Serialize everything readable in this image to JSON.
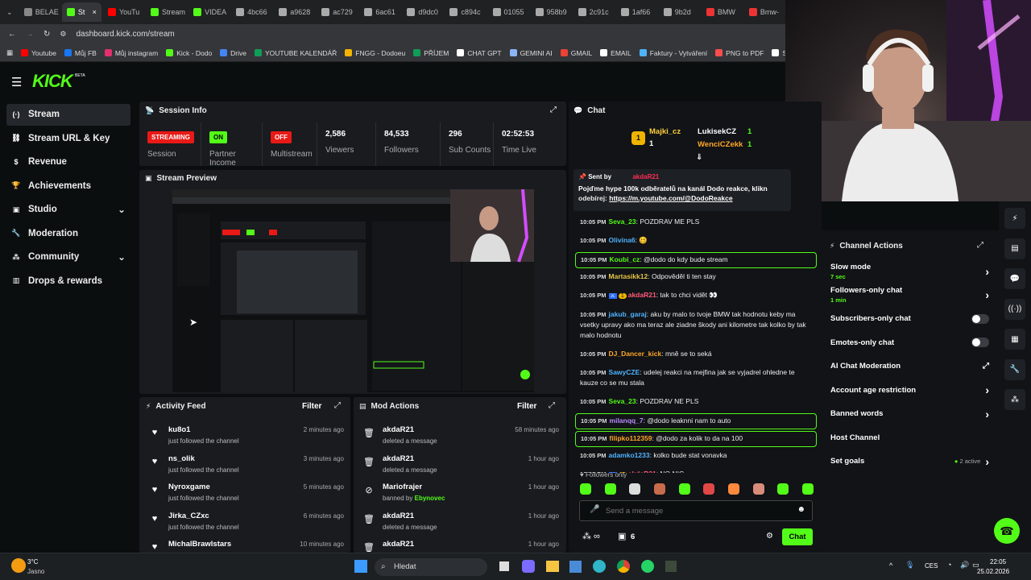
{
  "browser": {
    "tabs": [
      "BELAE",
      "St",
      "YouTu",
      "Stream",
      "VIDEA",
      "4bc66",
      "a9628",
      "ac729",
      "6ac61",
      "d9dc0",
      "c894c",
      "01055",
      "958b9",
      "2c91c",
      "1af66",
      "9b2d",
      "BMW",
      "Bmw-"
    ],
    "url": "dashboard.kick.com/stream",
    "bookmarks": [
      "Youtube",
      "Můj FB",
      "Můj instagram",
      "Kick - Dodo",
      "Drive",
      "YOUTUBE KALENDÁŘ",
      "FNGG - Dodoeu",
      "PŘÍJEM",
      "CHAT GPT",
      "GEMINI AI",
      "GMAIL",
      "EMAIL",
      "Faktury - Vytváření",
      "PNG to PDF",
      "S"
    ]
  },
  "header": {
    "logo": "KICK",
    "logo_sup": "BETA"
  },
  "sidebar": {
    "items": [
      {
        "label": "Stream",
        "icon": "stream-icon"
      },
      {
        "label": "Stream URL & Key",
        "icon": "link-icon"
      },
      {
        "label": "Revenue",
        "icon": "dollar-icon"
      },
      {
        "label": "Achievements",
        "icon": "trophy-icon"
      },
      {
        "label": "Studio",
        "icon": "tv-icon"
      },
      {
        "label": "Moderation",
        "icon": "wrench-icon"
      },
      {
        "label": "Community",
        "icon": "people-icon"
      },
      {
        "label": "Drops & rewards",
        "icon": "chart-icon"
      }
    ]
  },
  "session": {
    "title": "Session Info",
    "stats": [
      {
        "value": "STREAMING",
        "label": "Session",
        "chip": true,
        "color": "#e91916"
      },
      {
        "value": "ON",
        "label": "Partner Income",
        "chip": true,
        "color": "#53fc18"
      },
      {
        "value": "OFF",
        "label": "Multistream",
        "chip": true,
        "color": "#e91916"
      },
      {
        "value": "2,586",
        "label": "Viewers"
      },
      {
        "value": "84,533",
        "label": "Followers"
      },
      {
        "value": "296",
        "label": "Sub Counts"
      },
      {
        "value": "02:52:53",
        "label": "Time Live"
      }
    ]
  },
  "preview": {
    "title": "Stream Preview"
  },
  "activity": {
    "title": "Activity Feed",
    "filter": "Filter",
    "rows": [
      {
        "name": "ku8o1",
        "sub": "just followed the channel",
        "time": "2 minutes ago"
      },
      {
        "name": "ns_olik",
        "sub": "just followed the channel",
        "time": "3 minutes ago"
      },
      {
        "name": "Nyroxgame",
        "sub": "just followed the channel",
        "time": "5 minutes ago"
      },
      {
        "name": "Jirka_CZxc",
        "sub": "just followed the channel",
        "time": "6 minutes ago"
      },
      {
        "name": "MichalBrawlstars",
        "sub": "",
        "time": "10 minutes ago"
      }
    ]
  },
  "modactions": {
    "title": "Mod Actions",
    "filter": "Filter",
    "rows": [
      {
        "name": "akdaR21",
        "sub": "deleted a message",
        "time": "58 minutes ago"
      },
      {
        "name": "akdaR21",
        "sub": "deleted a message",
        "time": "1 hour ago"
      },
      {
        "name": "Mariofrajer",
        "sub": "banned by",
        "by": "Ebynovec",
        "time": "1 hour ago"
      },
      {
        "name": "akdaR21",
        "sub": "deleted a message",
        "time": "1 hour ago"
      },
      {
        "name": "akdaR21",
        "sub": "",
        "time": "1 hour ago"
      }
    ]
  },
  "chat": {
    "title": "Chat",
    "leaders": [
      {
        "name": "Majki_cz",
        "n": "1"
      },
      {
        "name": "LukisekCZ",
        "n": "1"
      },
      {
        "name": "WenciCZekk",
        "n": "1"
      }
    ],
    "pinned": {
      "sent_by": "Sent by",
      "user": "akdaR21",
      "text": "Pojďme hype 100k odběratelů na kanál Dodo reakce, klikn",
      "text2": "odebírej:",
      "link": "https://m.youtube.com/@DodoReakce"
    },
    "messages": [
      {
        "time": "10:05 PM",
        "user": "Seva_23",
        "color": "#53fc18",
        "text": "POZDRAV ME PLS"
      },
      {
        "time": "10:05 PM",
        "user": "Olivina6",
        "color": "#4fb3ff",
        "text": "🥴"
      },
      {
        "time": "10:05 PM",
        "user": "Koubi_cz",
        "color": "#53fc18",
        "text": "@dodo do kdy bude stream",
        "hl": true
      },
      {
        "time": "10:05 PM",
        "user": "Martasikk12",
        "color": "#e8c547",
        "text": "Odpověděl ti ten stay"
      },
      {
        "time": "10:05 PM",
        "user": "akdaR21",
        "color": "#ff5a7a",
        "text": "tak to chci vidět 👀"
      },
      {
        "time": "10:05 PM",
        "user": "jakub_garaj",
        "color": "#4fb3ff",
        "text": "aku by malo to tvoje BMW tak hodnotu keby ma vsetky upravy ako ma teraz ale ziadne škody ani kilometre tak kolko by tak malo hodnotu"
      },
      {
        "time": "10:05 PM",
        "user": "DJ_Dancer_kick",
        "color": "#ffa629",
        "text": "mně se to seká"
      },
      {
        "time": "10:05 PM",
        "user": "SawyCZE",
        "color": "#4fb3ff",
        "text": "udelej reakci na mejfina jak se vyjadrel ohledne te kauze co se mu stala"
      },
      {
        "time": "10:05 PM",
        "user": "Seva_23",
        "color": "#53fc18",
        "text": "POZDRAV NE PLS"
      },
      {
        "time": "10:05 PM",
        "user": "milanqq_7",
        "color": "#b68bff",
        "text": "@dodo leaknni nam to auto",
        "hl": true
      },
      {
        "time": "10:05 PM",
        "user": "filipko112359",
        "color": "#ffa629",
        "text": "@dodo za kolik to da na 100",
        "hl": true
      },
      {
        "time": "10:05 PM",
        "user": "adamko1233",
        "color": "#4fb3ff",
        "text": "kolko bude stat vonavka"
      },
      {
        "time": "10:05 PM",
        "user": "akdaR21",
        "color": "#ff5a7a",
        "text": "NO NIC"
      }
    ],
    "followers_only": "Followers only",
    "placeholder": "Send a message",
    "footer_count": "6",
    "chat_button": "Chat"
  },
  "channel_actions": {
    "title": "Channel Actions",
    "items": [
      {
        "label": "Slow mode",
        "sub": "7 sec",
        "kind": "chev"
      },
      {
        "label": "Followers-only chat",
        "sub": "1 min",
        "kind": "chev"
      },
      {
        "label": "Subscribers-only chat",
        "kind": "toggle"
      },
      {
        "label": "Emotes-only chat",
        "kind": "toggle"
      },
      {
        "label": "AI Chat Moderation",
        "kind": "ext"
      },
      {
        "label": "Account age restriction",
        "kind": "chev"
      },
      {
        "label": "Banned words",
        "kind": "chev"
      },
      {
        "label": "Host Channel",
        "kind": "none"
      },
      {
        "label": "Set goals",
        "kind": "chev",
        "badge": "2 active"
      }
    ]
  },
  "taskbar": {
    "temp": "3°C",
    "weather": "Jasno",
    "search": "Hledat",
    "lang": "CES",
    "time": "22:05",
    "date": "25.02.2026"
  }
}
